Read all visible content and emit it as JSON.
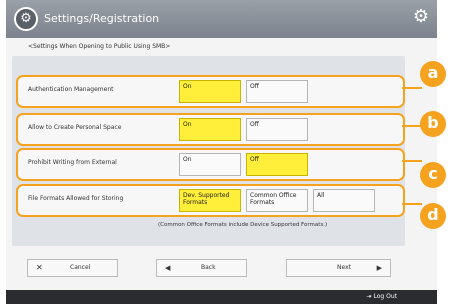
{
  "window": {
    "title": "Settings/Registration"
  },
  "subtitle": "<Settings When Opening to Public Using SMB>",
  "rows": [
    {
      "label": "Authentication Management",
      "options": [
        "On",
        "Off"
      ],
      "selected": 0
    },
    {
      "label": "Allow to Create Personal Space",
      "options": [
        "On",
        "Off"
      ],
      "selected": 0
    },
    {
      "label": "Prohibit Writing from External",
      "options": [
        "On",
        "Off"
      ],
      "selected": 1
    },
    {
      "label": "File Formats Allowed for Storing",
      "options": [
        "Dev. Supported Formats",
        "Common Office Formats",
        "All"
      ],
      "selected": 0
    }
  ],
  "note": "(Common Office Formats include Device Supported Formats.)",
  "nav": {
    "cancel": "Cancel",
    "back": "Back",
    "next": "Next"
  },
  "status": {
    "logout": "Log Out"
  },
  "callouts": [
    "a",
    "b",
    "c",
    "d"
  ],
  "colors": {
    "accent": "#f5a21e",
    "selected": "#ffef3a"
  }
}
